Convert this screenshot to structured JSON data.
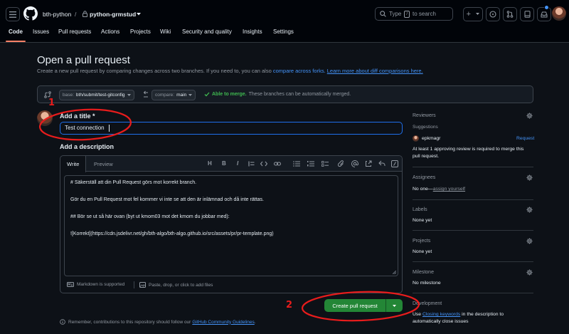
{
  "header": {
    "owner": "bth-python",
    "separator": "/",
    "repo": "python-grmstud",
    "search_prefix": "Type",
    "search_key": "/",
    "search_suffix": "to search",
    "plus_label": "+"
  },
  "nav": {
    "tabs": [
      "Code",
      "Issues",
      "Pull requests",
      "Actions",
      "Projects",
      "Wiki",
      "Security and quality",
      "Insights",
      "Settings"
    ]
  },
  "page": {
    "title": "Open a pull request",
    "subtitle_text": "Create a new pull request by comparing changes across two branches. If you need to, you can also",
    "compare_forks_link": "compare across forks.",
    "learn_more_link": "Learn more about diff comparisons here."
  },
  "compare": {
    "base_prefix": "base:",
    "base_branch": "bth/submit/test-gitconfig",
    "compare_prefix": "compare:",
    "compare_branch": "main",
    "merge_status": "Able to merge.",
    "merge_detail": "These branches can be automatically merged."
  },
  "form": {
    "title_label": "Add a title",
    "required_mark": "*",
    "title_value": "Test connection",
    "description_label": "Add a description",
    "write_tab": "Write",
    "preview_tab": "Preview",
    "toolbar": {
      "heading": "H",
      "bold": "B",
      "italic": "I"
    },
    "description_lines": [
      "# Säkerställ att din Pull Request görs mot korrekt branch.",
      "Gör du en Pull Request mot fel kommer vi inte se att den är inlämnad och då inte rättas.",
      "## Bör se ut så här ovan (byt ut kmom03 mot det kmom du jobbar med):",
      "![Korrekt](https://cdn.jsdelivr.net/gh/bth-algo/bth-algo.github.io/src/assets/pr/pr-template.png)"
    ],
    "markdown_note": "Markdown is supported",
    "paste_note": "Paste, drop, or click to add files",
    "create_button": "Create pull request",
    "remember_text": "Remember, contributions to this repository should follow our",
    "guidelines_link": "GitHub Community Guidelines",
    "remember_end": "."
  },
  "sidebar": {
    "reviewers_title": "Reviewers",
    "suggestions_label": "Suggestions",
    "suggested_user": "epkmagr",
    "request_link": "Request",
    "review_note_line1": "At least 1 approving review is required to merge this",
    "review_note_line2": "pull request.",
    "assignees_title": "Assignees",
    "assignees_value": "No one—",
    "assign_yourself": "assign yourself",
    "labels_title": "Labels",
    "labels_value": "None yet",
    "projects_title": "Projects",
    "projects_value": "None yet",
    "milestone_title": "Milestone",
    "milestone_value": "No milestone",
    "development_title": "Development",
    "development_use": "Use",
    "closing_keywords": "Closing keywords",
    "development_rest": "in the description to",
    "development_line2": "automatically close issues"
  },
  "annotations": {
    "marker_1": "1",
    "marker_2": "2"
  },
  "colors": {
    "accent": "#1f6feb",
    "link": "#4493f8",
    "success": "#3fb950",
    "button_green": "#238636",
    "annotation_red": "#e81c1c"
  }
}
